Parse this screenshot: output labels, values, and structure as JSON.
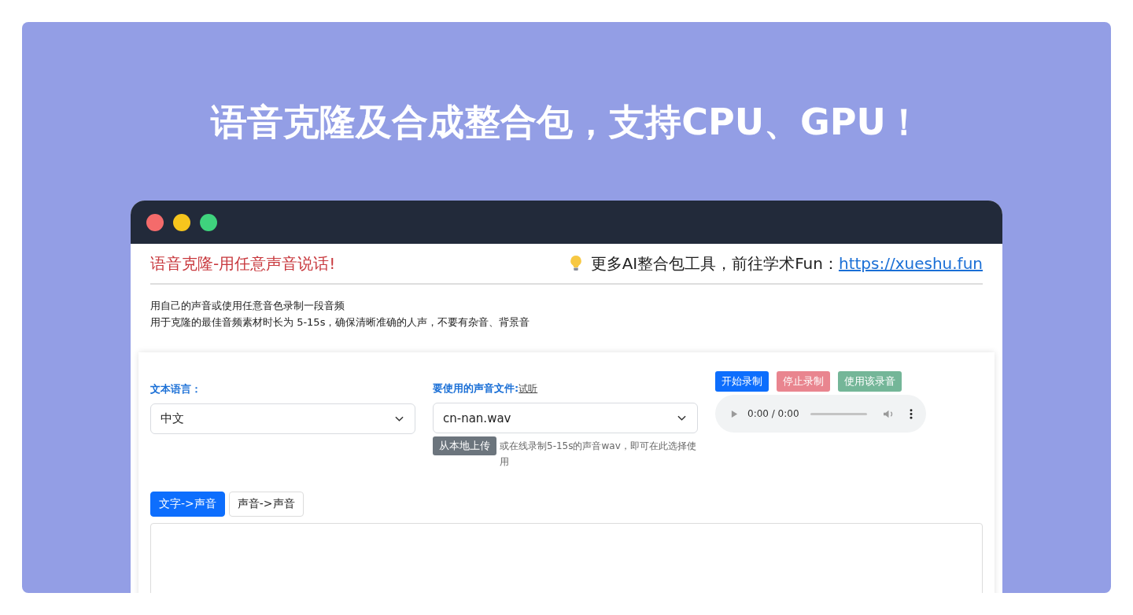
{
  "banner": {
    "title": "语音克隆及合成整合包，支持CPU、GPU！"
  },
  "window": {
    "header": {
      "title": "语音克隆-用任意声音说话!",
      "promo": "更多AI整合包工具，前往学术Fun：",
      "link": "https://xueshu.fun"
    },
    "intro": [
      "用自己的声音或使用任意音色录制一段音频",
      "用于克隆的最佳音频素材时长为 5-15s，确保清晰准确的人声，不要有杂音、背景音"
    ],
    "language": {
      "label": "文本语言：",
      "value": "中文"
    },
    "voice_file": {
      "label": "要使用的声音文件:",
      "link": "试听",
      "value": "cn-nan.wav",
      "upload_button": "从本地上传",
      "hint": "或在线录制5-15s的声音wav，即可在此选择使用"
    },
    "record_buttons": [
      {
        "label": "开始录制",
        "kind": "primary",
        "disabled": false
      },
      {
        "label": "停止录制",
        "kind": "danger",
        "disabled": true
      },
      {
        "label": "使用该录音",
        "kind": "success",
        "disabled": true
      }
    ],
    "audio_player": {
      "time": "0:00 / 0:00"
    },
    "tabs": [
      {
        "label": "文字->声音",
        "selected": true
      },
      {
        "label": "声音->声音",
        "selected": false
      }
    ]
  }
}
